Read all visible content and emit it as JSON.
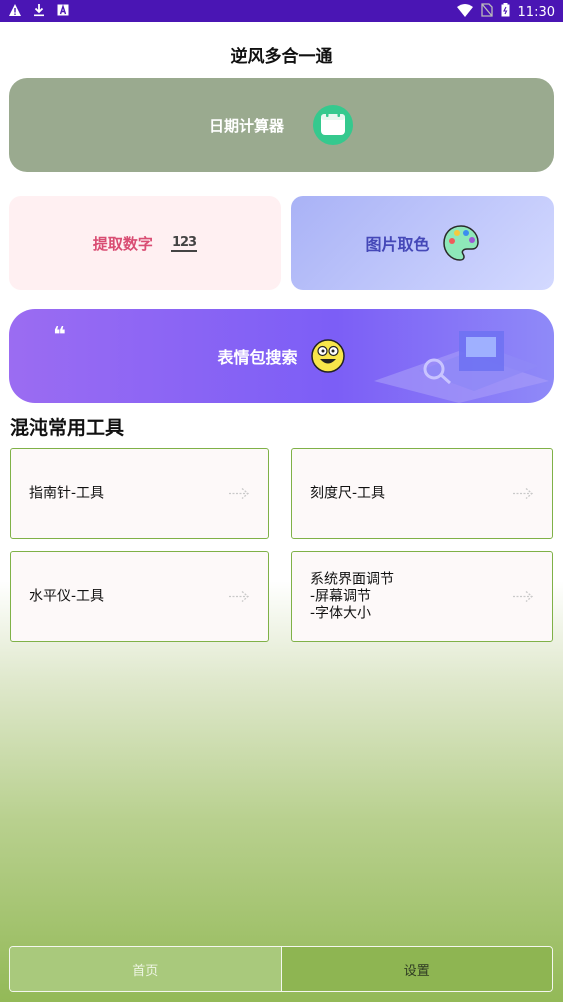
{
  "status_bar": {
    "time": "11:30"
  },
  "app": {
    "title": "逆风多合一通"
  },
  "cards": {
    "date_calc": {
      "label": "日期计算器"
    },
    "extract_number": {
      "label": "提取数字",
      "badge": "123"
    },
    "color_pick": {
      "label": "图片取色"
    },
    "emoji_search": {
      "label": "表情包搜索"
    }
  },
  "section": {
    "title": "混沌常用工具"
  },
  "tools": [
    {
      "label": "指南针-工具"
    },
    {
      "label": "刻度尺-工具"
    },
    {
      "label": "水平仪-工具"
    },
    {
      "label": "系统界面调节\n-屏幕调节\n-字体大小"
    }
  ],
  "bottom_nav": {
    "home": "首页",
    "settings": "设置"
  }
}
